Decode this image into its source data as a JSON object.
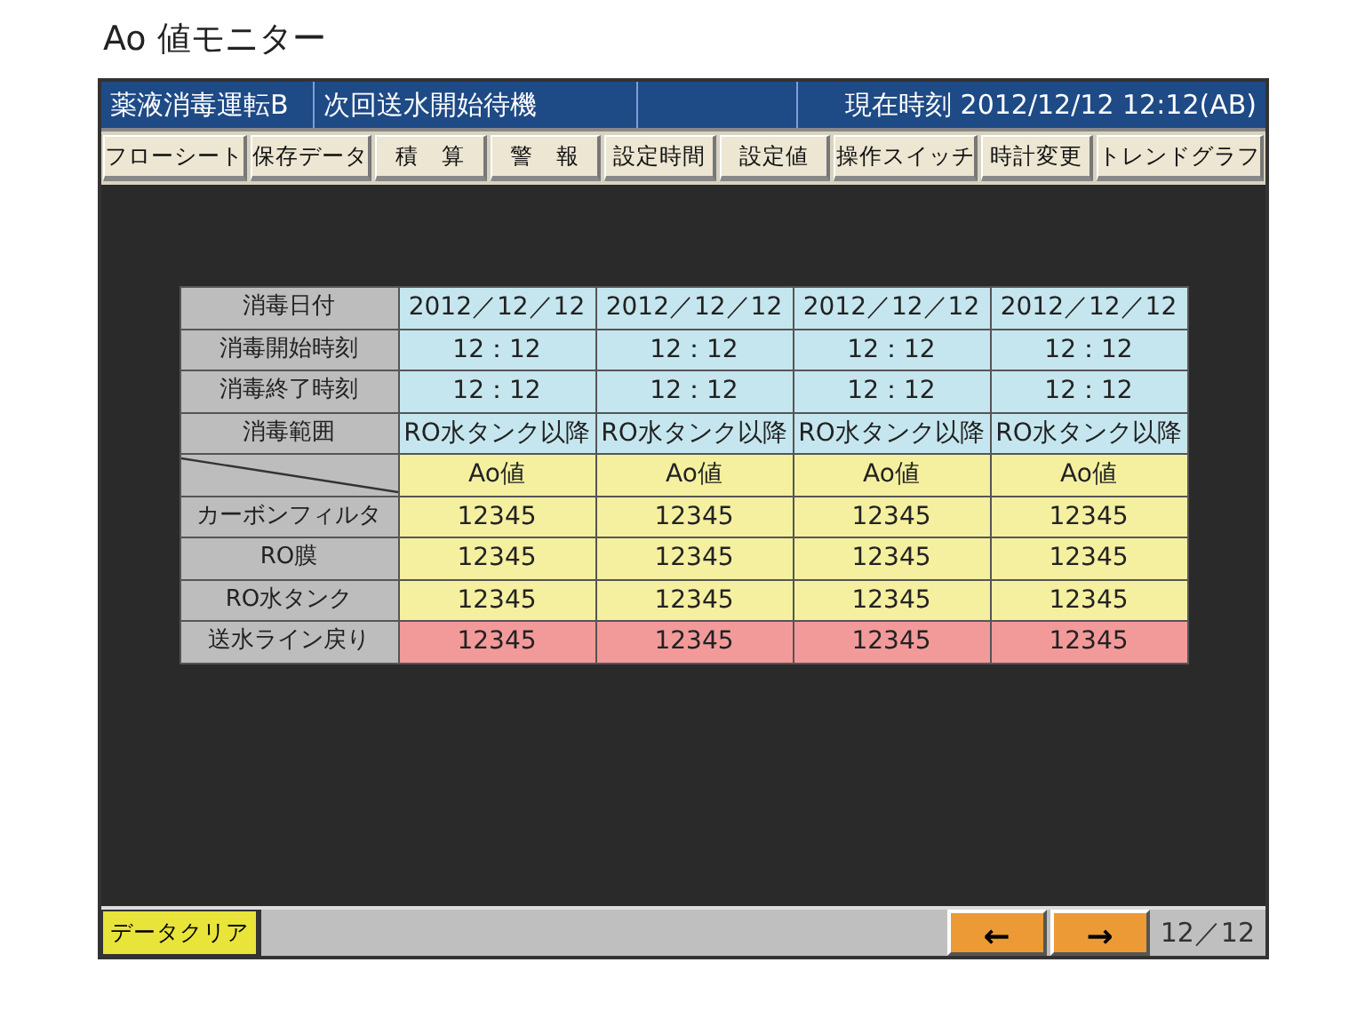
{
  "page_title": "Ao 値モニター",
  "header": {
    "mode": "薬液消毒運転B",
    "status": "次回送水開始待機",
    "clock": "現在時刻 2012/12/12  12:12(AB)"
  },
  "menu": [
    "フローシート",
    "保存データ",
    "積　算",
    "警　報",
    "設定時間",
    "設定値",
    "操作スイッチ",
    "時計変更",
    "トレンドグラフ"
  ],
  "table": {
    "rows": [
      {
        "kind": "label",
        "label": "消毒日付",
        "color": "#c5e6ee",
        "cells": [
          "2012／12／12",
          "2012／12／12",
          "2012／12／12",
          "2012／12／12"
        ]
      },
      {
        "kind": "label",
        "label": "消毒開始時刻",
        "color": "#c5e6ee",
        "cells": [
          "12：12",
          "12：12",
          "12：12",
          "12：12"
        ]
      },
      {
        "kind": "label",
        "label": "消毒終了時刻",
        "color": "#c5e6ee",
        "cells": [
          "12：12",
          "12：12",
          "12：12",
          "12：12"
        ]
      },
      {
        "kind": "label",
        "label": "消毒範囲",
        "color": "#c5e6ee",
        "cells": [
          "RO水タンク以降",
          "RO水タンク以降",
          "RO水タンク以降",
          "RO水タンク以降"
        ]
      },
      {
        "kind": "diagonal",
        "color": "#f4f0a0",
        "cells": [
          "Ao値",
          "Ao値",
          "Ao値",
          "Ao値"
        ]
      },
      {
        "kind": "label",
        "label": "カーボンフィルタ",
        "color": "#f4f0a0",
        "cells": [
          "12345",
          "12345",
          "12345",
          "12345"
        ]
      },
      {
        "kind": "label",
        "label": "RO膜",
        "color": "#f4f0a0",
        "cells": [
          "12345",
          "12345",
          "12345",
          "12345"
        ]
      },
      {
        "kind": "label",
        "label": "RO水タンク",
        "color": "#f4f0a0",
        "cells": [
          "12345",
          "12345",
          "12345",
          "12345"
        ]
      },
      {
        "kind": "label",
        "label": "送水ライン戻り",
        "color": "#f29a9a",
        "cells": [
          "12345",
          "12345",
          "12345",
          "12345"
        ]
      }
    ]
  },
  "footer": {
    "clear_button": "データクリア",
    "prev_button": "←",
    "next_button": "→",
    "page": "12／12"
  }
}
